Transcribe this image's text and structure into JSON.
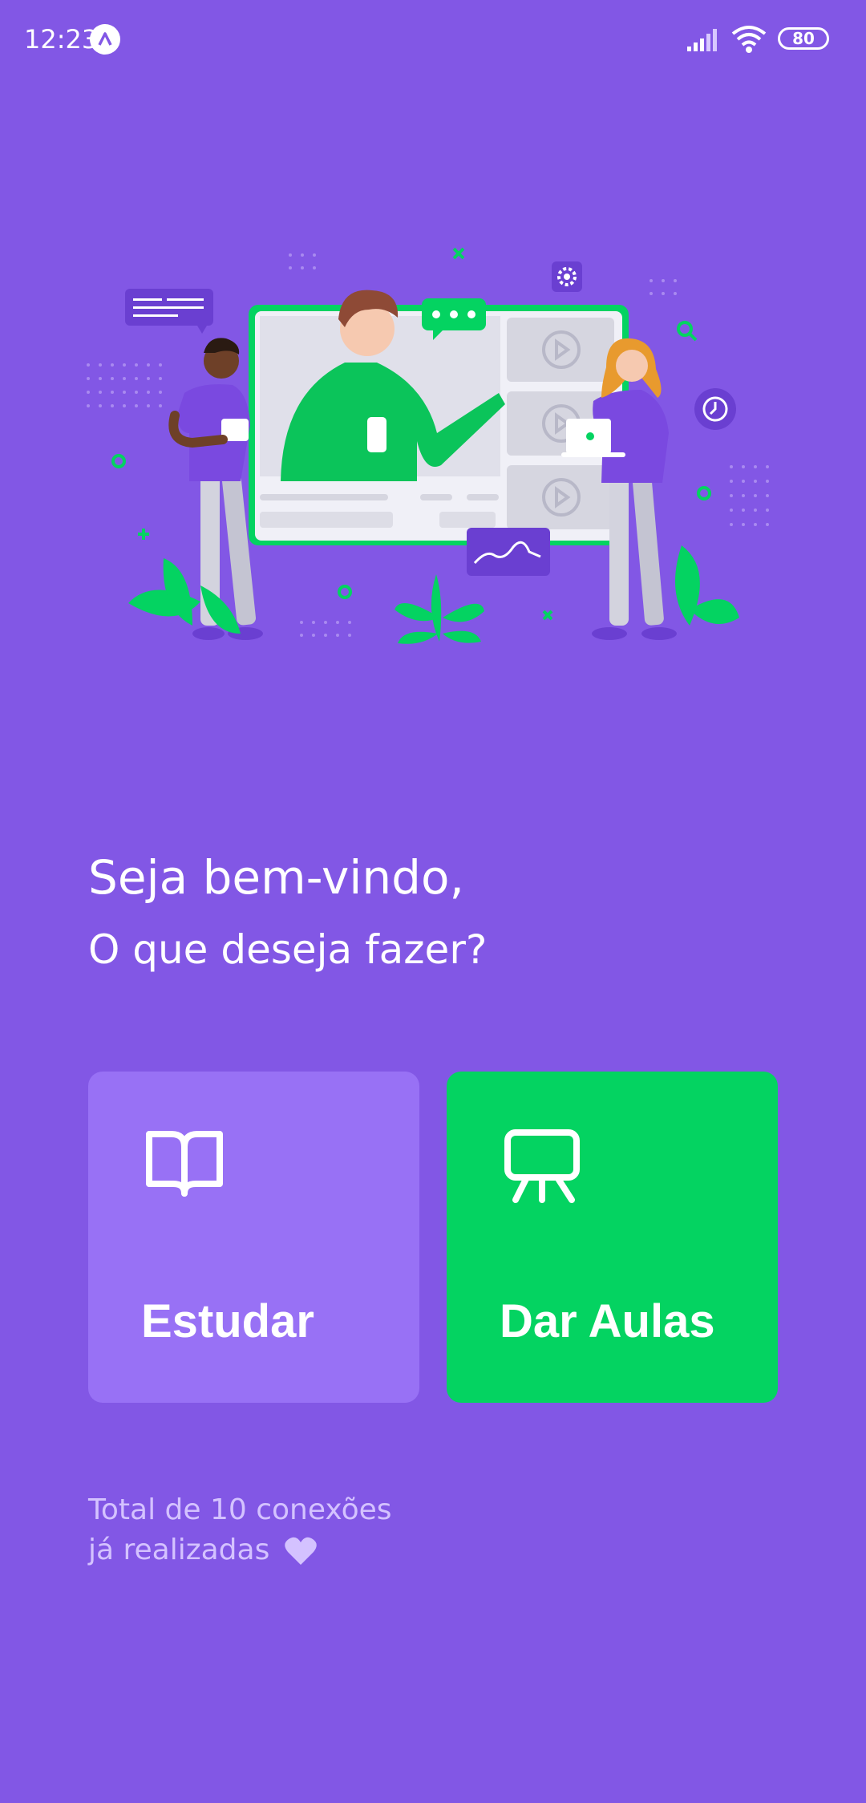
{
  "status_bar": {
    "time": "12:23",
    "battery": "80",
    "icons": [
      "app-badge-icon",
      "signal-icon",
      "wifi-icon",
      "battery-icon"
    ]
  },
  "hero": {
    "icons": [
      "chat-bubble-icon",
      "gear-icon",
      "clock-icon",
      "play-icon",
      "chart-icon",
      "plant-icon",
      "search-icon"
    ]
  },
  "welcome": {
    "title": "Seja bem-vindo,",
    "subtitle": "O que deseja fazer?"
  },
  "actions": {
    "study_label": "Estudar",
    "teach_label": "Dar Aulas"
  },
  "footer": {
    "line1": "Total de 10 conexões",
    "line2": "já realizadas"
  },
  "colors": {
    "background": "#8257E5",
    "study_card": "#9871F5",
    "teach_card": "#04D361",
    "footer_text": "#D4C2FF"
  }
}
